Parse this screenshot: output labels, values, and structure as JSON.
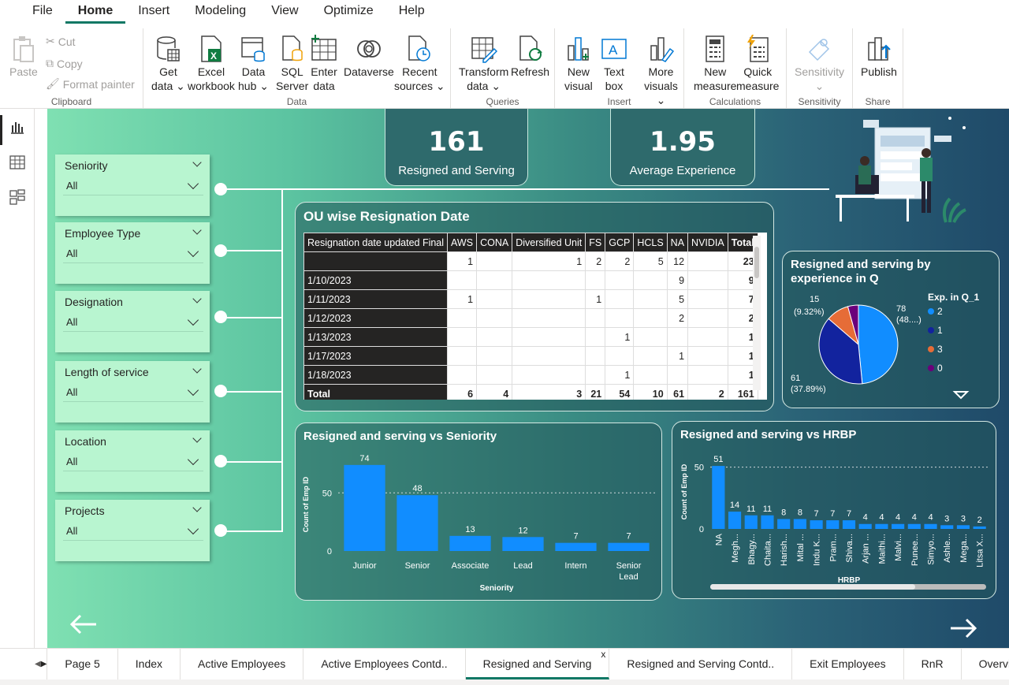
{
  "menu": [
    "File",
    "Home",
    "Insert",
    "Modeling",
    "View",
    "Optimize",
    "Help"
  ],
  "ribbon": {
    "clipboard": {
      "paste": "Paste",
      "cut": "Cut",
      "copy": "Copy",
      "format_painter": "Format painter",
      "label": "Clipboard"
    },
    "data": {
      "get_data": [
        "Get",
        "data ⌄"
      ],
      "excel": [
        "Excel",
        "workbook"
      ],
      "data_hub": [
        "Data",
        "hub ⌄"
      ],
      "sql": [
        "SQL",
        "Server"
      ],
      "enter": [
        "Enter",
        "data"
      ],
      "dataverse": [
        "Dataverse",
        ""
      ],
      "recent": [
        "Recent",
        "sources ⌄"
      ],
      "label": "Data"
    },
    "queries": {
      "transform": [
        "Transform",
        "data ⌄"
      ],
      "refresh": [
        "Refresh",
        ""
      ],
      "label": "Queries"
    },
    "insert": {
      "new_visual": [
        "New",
        "visual"
      ],
      "text_box": [
        "Text",
        "box"
      ],
      "more_visuals": [
        "More",
        "visuals ⌄"
      ],
      "label": "Insert"
    },
    "calculations": {
      "new_measure": [
        "New",
        "measure"
      ],
      "quick_measure": [
        "Quick",
        "measure"
      ],
      "label": "Calculations"
    },
    "sensitivity": {
      "btn": [
        "Sensitivity",
        "⌄"
      ],
      "label": "Sensitivity"
    },
    "share": {
      "publish": [
        "Publish",
        ""
      ],
      "label": "Share"
    }
  },
  "kpis": [
    {
      "value": "161",
      "label": "Resigned and Serving"
    },
    {
      "value": "1.95",
      "label": "Average Experience"
    }
  ],
  "slicers": [
    {
      "title": "Seniority",
      "value": "All"
    },
    {
      "title": "Employee Type",
      "value": "All"
    },
    {
      "title": "Designation",
      "value": "All"
    },
    {
      "title": "Length of service",
      "value": "All"
    },
    {
      "title": "Location",
      "value": "All"
    },
    {
      "title": "Projects",
      "value": "All"
    }
  ],
  "matrix": {
    "title": "OU wise Resignation Date",
    "columns": [
      "Resignation date updated Final",
      "AWS",
      "CONA",
      "Diversified Unit",
      "FS",
      "GCP",
      "HCLS",
      "NA",
      "NVIDIA",
      "Total"
    ],
    "rows": [
      [
        "",
        "1",
        "",
        "1",
        "2",
        "2",
        "5",
        "12",
        "",
        "23"
      ],
      [
        "1/10/2023",
        "",
        "",
        "",
        "",
        "",
        "",
        "9",
        "",
        "9"
      ],
      [
        "1/11/2023",
        "1",
        "",
        "",
        "1",
        "",
        "",
        "5",
        "",
        "7"
      ],
      [
        "1/12/2023",
        "",
        "",
        "",
        "",
        "",
        "",
        "2",
        "",
        "2"
      ],
      [
        "1/13/2023",
        "",
        "",
        "",
        "",
        "1",
        "",
        "",
        "",
        "1"
      ],
      [
        "1/17/2023",
        "",
        "",
        "",
        "",
        "",
        "",
        "1",
        "",
        "1"
      ],
      [
        "1/18/2023",
        "",
        "",
        "",
        "",
        "1",
        "",
        "",
        "",
        "1"
      ]
    ],
    "total": [
      "Total",
      "6",
      "4",
      "3",
      "21",
      "54",
      "10",
      "61",
      "2",
      "161"
    ]
  },
  "chart_data": [
    {
      "type": "pie",
      "title": "Resigned and serving by experience in Q",
      "legend_title": "Exp. in Q_1",
      "categories": [
        "2",
        "1",
        "3",
        "0"
      ],
      "values": [
        78,
        61,
        15,
        7
      ],
      "colors": [
        "#118dff",
        "#12239e",
        "#e66c37",
        "#6b007b"
      ],
      "labels": [
        "78",
        "(48....)",
        "61",
        "(37.89%)",
        "15",
        "(9.32%)"
      ]
    },
    {
      "type": "bar",
      "title": "Resigned and serving vs Seniority",
      "categories": [
        "Junior",
        "Senior",
        "Associate",
        "Lead",
        "Intern",
        "Senior Lead"
      ],
      "values": [
        74,
        48,
        13,
        12,
        7,
        7
      ],
      "xlabel": "Seniority",
      "ylabel": "Count of Emp ID",
      "yticks": [
        "0",
        "50"
      ]
    },
    {
      "type": "bar",
      "title": "Resigned and serving vs HRBP",
      "categories": [
        "NA",
        "Megh...",
        "Bhagy...",
        "Chaita...",
        "Harish...",
        "Mital ...",
        "Indu K...",
        "Pram...",
        "Shiva...",
        "Arjan ...",
        "Maithi...",
        "Malvi...",
        "Punee...",
        "Simyo...",
        "Ashle...",
        "Mega...",
        "Litsa X..."
      ],
      "values": [
        51,
        14,
        11,
        11,
        8,
        8,
        7,
        7,
        7,
        4,
        4,
        4,
        4,
        4,
        3,
        3,
        2
      ],
      "xlabel": "HRBP",
      "ylabel": "Count of Emp ID",
      "yticks": [
        "0",
        "50"
      ]
    }
  ],
  "tabs": [
    "Page 5",
    "Index",
    "Active Employees",
    "Active Employees Contd..",
    "Resigned and Serving",
    "Resigned and Serving Contd..",
    "Exit Employees",
    "RnR",
    "Overvie"
  ],
  "active_tab": "Resigned and Serving",
  "tab_close": "x",
  "colors": {
    "accent": "#117865",
    "bar": "#118dff"
  }
}
